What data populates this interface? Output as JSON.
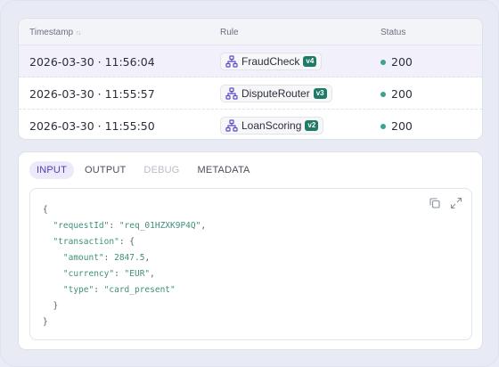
{
  "table": {
    "headers": {
      "timestamp": "Timestamp",
      "sort_glyph": "↑↓",
      "rule": "Rule",
      "status": "Status"
    },
    "rows": [
      {
        "timestamp": "2026-03-30 · 11:56:04",
        "rule": "FraudCheck",
        "version": "v4",
        "status": "200",
        "selected": true
      },
      {
        "timestamp": "2026-03-30 · 11:55:57",
        "rule": "DisputeRouter",
        "version": "v3",
        "status": "200",
        "selected": false
      },
      {
        "timestamp": "2026-03-30 · 11:55:50",
        "rule": "LoanScoring",
        "version": "v2",
        "status": "200",
        "selected": false
      }
    ],
    "status_color": "#3aa58e",
    "version_badge_color": "#1f7a67",
    "rule_icon": "hierarchy-icon"
  },
  "detail": {
    "tabs": [
      {
        "label": "INPUT",
        "state": "active"
      },
      {
        "label": "OUTPUT",
        "state": "normal"
      },
      {
        "label": "DEBUG",
        "state": "disabled"
      },
      {
        "label": "METADATA",
        "state": "normal"
      }
    ],
    "tools": [
      "copy-icon",
      "expand-icon"
    ],
    "json": {
      "open_brace": "{",
      "requestId_key": "\"requestId\"",
      "requestId_value": "\"req_01HZXK9P4Q\"",
      "transaction_key": "\"transaction\"",
      "amount_key": "\"amount\"",
      "amount_value": "2847.5",
      "currency_key": "\"currency\"",
      "currency_value": "\"EUR\"",
      "type_key": "\"type\"",
      "type_value": "\"card_present\"",
      "inner_close": "}",
      "close_brace": "}"
    }
  },
  "accent_color": "#4b3fb5"
}
